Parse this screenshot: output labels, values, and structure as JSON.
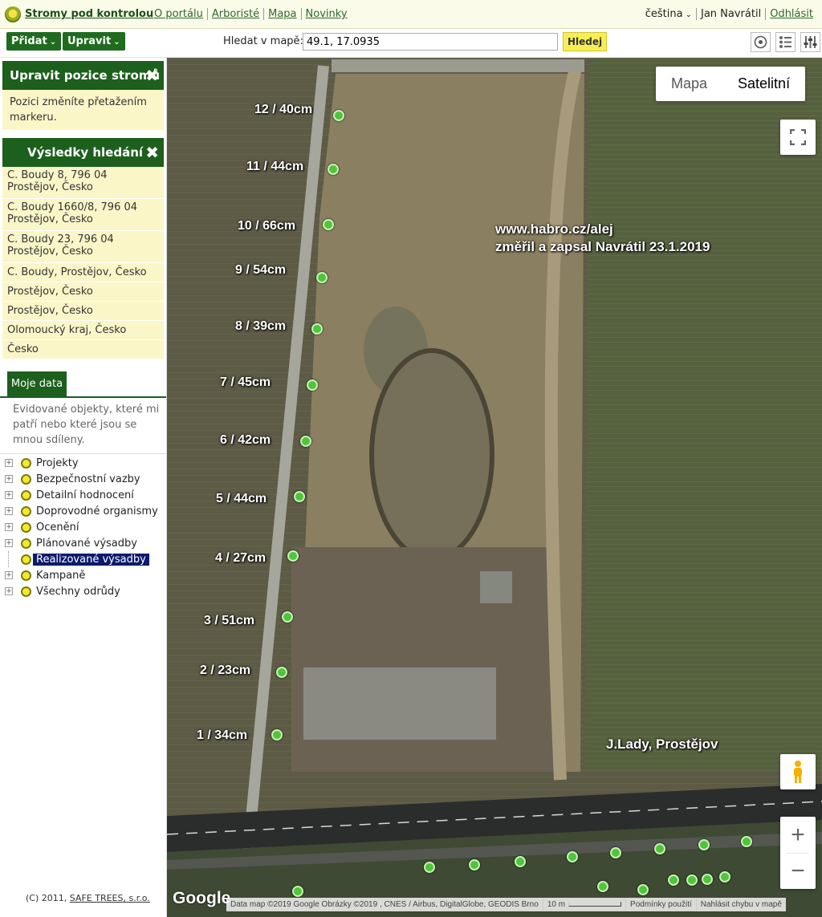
{
  "topbar": {
    "brand": "Stromy pod kontrolou",
    "links": [
      "O portálu",
      "Arboristé",
      "Mapa",
      "Novinky"
    ],
    "language": "čeština",
    "user": "Jan Navrátil",
    "logout": "Odhlásit"
  },
  "toolbar": {
    "add_label": "Přidat",
    "edit_label": "Upravit",
    "search_label": "Hledat v mapě:",
    "search_value": "49.1, 17.0935",
    "search_button": "Hledej"
  },
  "sidebar": {
    "edit_panel": {
      "title": "Upravit pozice stromů",
      "note": "Pozici změníte přetažením markeru."
    },
    "results_panel": {
      "title": "Výsledky hledání",
      "results": [
        "C. Boudy 8, 796 04 Prostějov, Česko",
        "C. Boudy 1660/8, 796 04 Prostějov, Česko",
        "C. Boudy 23, 796 04 Prostějov, Česko",
        "C. Boudy, Prostějov, Česko",
        "Prostějov, Česko",
        "Prostějov, Česko",
        "Olomoucký kraj, Česko",
        "Česko"
      ]
    },
    "my_data": {
      "tab": "Moje data",
      "description": "Evidované objekty, které mi patří nebo které jsou se mnou sdíleny.",
      "tree": [
        "Projekty",
        "Bezpečnostní vazby",
        "Detailní hodnocení",
        "Doprovodné organismy",
        "Ocenění",
        "Plánované výsadby",
        "Realizované výsadby",
        "Kampaně",
        "Všechny odrůdy"
      ],
      "selected": "Realizované výsadby"
    },
    "footer": {
      "copyright": "(C) 2011, ",
      "company": "SAFE TREES, s.r.o."
    }
  },
  "map": {
    "type_buttons": {
      "map": "Mapa",
      "satellite": "Satelitní"
    },
    "tree_labels": [
      "12 / 40cm",
      "11 / 44cm",
      "10 / 66cm",
      "9 / 54cm",
      "8 / 39cm",
      "7 / 45cm",
      "6 / 42cm",
      "5 / 44cm",
      "4 / 27cm",
      "3 / 51cm",
      "2 / 23cm",
      "1 / 34cm"
    ],
    "note_line1": "www.habro.cz/alej",
    "note_line2": "změřil a zapsal Navrátil 23.1.2019",
    "location_note": "J.Lady, Prostějov",
    "google": "Google",
    "attribution": {
      "data": "Data map ©2019 Google Obrázky ©2019 , CNES / Airbus, DigitalGlobe, GEODIS Brno",
      "scale": "10 m",
      "terms": "Podmínky použití",
      "report": "Nahlásit chybu v mapě"
    },
    "colors": {
      "marker": "#4fc53a",
      "sidebar_green": "#1d5f1d"
    }
  }
}
